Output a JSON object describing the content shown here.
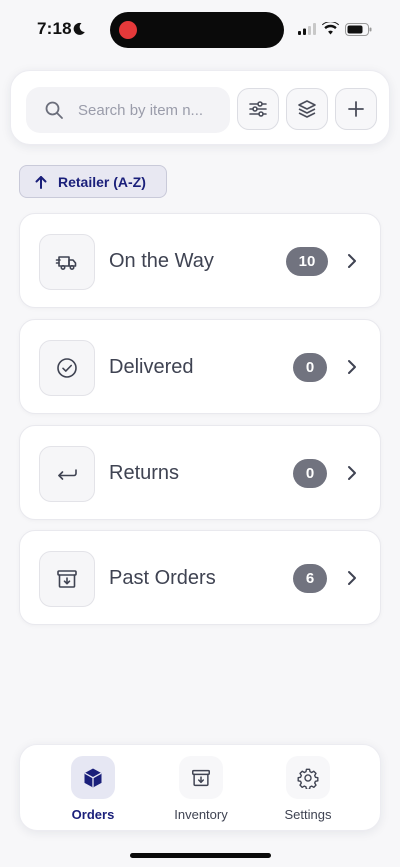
{
  "status_bar": {
    "time": "7:18"
  },
  "search": {
    "placeholder": "Search by item n..."
  },
  "sort": {
    "label": "Retailer (A-Z)"
  },
  "orders": [
    {
      "label": "On the Way",
      "count": "10",
      "icon": "truck-icon"
    },
    {
      "label": "Delivered",
      "count": "0",
      "icon": "check-circle-icon"
    },
    {
      "label": "Returns",
      "count": "0",
      "icon": "return-arrow-icon"
    },
    {
      "label": "Past Orders",
      "count": "6",
      "icon": "archive-icon"
    }
  ],
  "nav": {
    "items": [
      {
        "label": "Orders",
        "icon": "cube-icon",
        "active": true
      },
      {
        "label": "Inventory",
        "icon": "archive-icon",
        "active": false
      },
      {
        "label": "Settings",
        "icon": "gear-icon",
        "active": false
      }
    ]
  },
  "colors": {
    "accent": "#1a1f7a",
    "badge": "#71737f",
    "recording": "#e5393a"
  }
}
